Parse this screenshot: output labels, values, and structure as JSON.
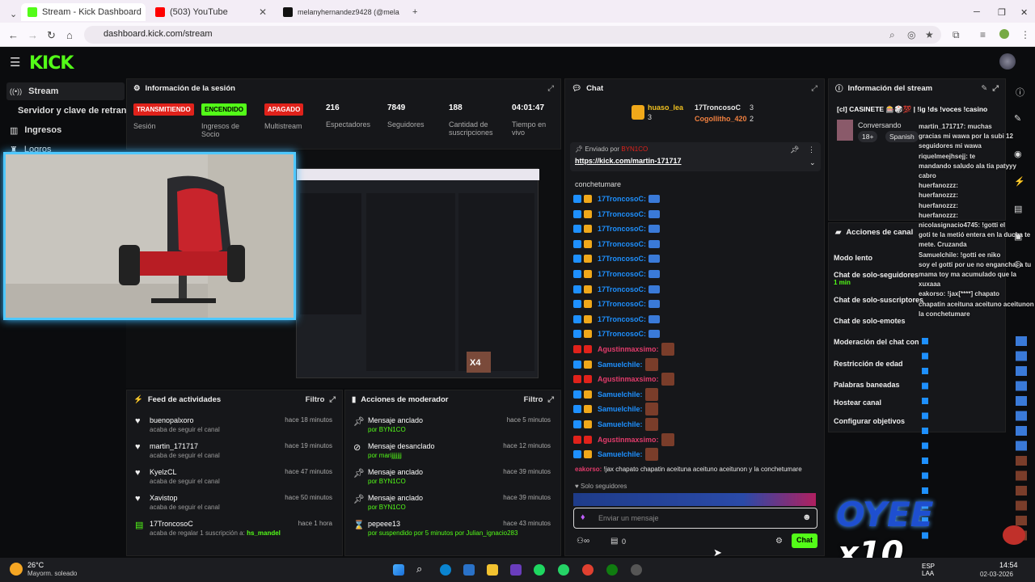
{
  "browser": {
    "tabs": [
      {
        "title": "Stream - Kick Dashboard",
        "active": true
      },
      {
        "title": "(503) YouTube",
        "active": false
      },
      {
        "title": "melanyhernandez9428 (@mela",
        "active": false
      }
    ],
    "url": "dashboard.kick.com/stream"
  },
  "brand": {
    "logo": "KICK",
    "accent": "#53fc18"
  },
  "sidebar": {
    "items": [
      {
        "label": "Stream",
        "icon": "radio-icon"
      },
      {
        "label": "Servidor y clave de retransm",
        "icon": ""
      },
      {
        "label": "Ingresos",
        "icon": "bank-icon"
      },
      {
        "label": "Logros",
        "icon": "trophy-icon"
      }
    ]
  },
  "session": {
    "title": "Información de la sesión",
    "stats": [
      {
        "badge": "TRANSMITIENDO",
        "label": "Sesión"
      },
      {
        "badge": "ENCENDIDO",
        "label": "Ingresos de Socio"
      },
      {
        "badge": "APAGADO",
        "label": "Multistream"
      },
      {
        "value": "216",
        "label": "Espectadores"
      },
      {
        "value": "7849",
        "label": "Seguidores"
      },
      {
        "value": "188",
        "label": "Cantidad de suscripciones"
      },
      {
        "value": "04:01:47",
        "label": "Tiempo en vivo"
      }
    ]
  },
  "feed": {
    "title": "Feed de actividades",
    "filter": "Filtro",
    "items": [
      {
        "name": "buenopalxoro",
        "sub": "acaba de seguir el canal",
        "time": "hace 18 minutos"
      },
      {
        "name": "martin_171717",
        "sub": "acaba de seguir el canal",
        "time": "hace 19 minutos"
      },
      {
        "name": "KyelzCL",
        "sub": "acaba de seguir el canal",
        "time": "hace 47 minutos"
      },
      {
        "name": "Xavistop",
        "sub": "acaba de seguir el canal",
        "time": "hace 50 minutos"
      },
      {
        "name": "17TroncosoC",
        "sub": "acaba de regalar 1 suscripción a:",
        "extra": "hs_mandel",
        "time": "hace 1 hora"
      }
    ]
  },
  "modactions": {
    "title": "Acciones de moderador",
    "filter": "Filtro",
    "items": [
      {
        "name": "Mensaje anclado",
        "sub": "por BYN1CO",
        "time": "hace 5 minutos"
      },
      {
        "name": "Mensaje desanclado",
        "sub": "por marijjjjjjj",
        "time": "hace 12 minutos"
      },
      {
        "name": "Mensaje anclado",
        "sub": "por BYN1CO",
        "time": "hace 39 minutos"
      },
      {
        "name": "Mensaje anclado",
        "sub": "por BYN1CO",
        "time": "hace 39 minutos"
      },
      {
        "name": "pepeee13",
        "sub": "por suspendido por 5 minutos por Julian_ignacio283",
        "time": "hace 43 minutos"
      }
    ]
  },
  "chat": {
    "title": "Chat",
    "top": [
      {
        "name": "huaso_lea",
        "count": "3"
      },
      {
        "name": "17TroncosoC",
        "count": "3"
      },
      {
        "name": "Cogollitho_420",
        "count": "2"
      }
    ],
    "pinned_by": "Enviado por",
    "pinned_user": "BYN1CO",
    "pinned_link": "https://kick.com/martin-171717",
    "pinned_tail": "conchetumare",
    "messages": [
      {
        "user": "17TroncosoC:",
        "color": "#1e90ff"
      },
      {
        "user": "17TroncosoC:",
        "color": "#1e90ff"
      },
      {
        "user": "17TroncosoC:",
        "color": "#1e90ff"
      },
      {
        "user": "17TroncosoC:",
        "color": "#1e90ff"
      },
      {
        "user": "17TroncosoC:",
        "color": "#1e90ff"
      },
      {
        "user": "17TroncosoC:",
        "color": "#1e90ff"
      },
      {
        "user": "17TroncosoC:",
        "color": "#1e90ff"
      },
      {
        "user": "17TroncosoC:",
        "color": "#1e90ff"
      },
      {
        "user": "17TroncosoC:",
        "color": "#1e90ff"
      },
      {
        "user": "17TroncosoC:",
        "color": "#1e90ff"
      },
      {
        "user": "Agustinmaxsimo:",
        "color": "#e23b6b"
      },
      {
        "user": "Samuelchile:",
        "color": "#1e90ff"
      },
      {
        "user": "Agustinmaxsimo:",
        "color": "#e23b6b"
      },
      {
        "user": "Samuelchile:",
        "color": "#1e90ff"
      },
      {
        "user": "Samuelchile:",
        "color": "#1e90ff"
      },
      {
        "user": "Samuelchile:",
        "color": "#1e90ff"
      },
      {
        "user": "Agustinmaxsimo:",
        "color": "#e23b6b"
      },
      {
        "user": "Samuelchile:",
        "color": "#1e90ff"
      }
    ],
    "last_user": "eakorso:",
    "last_text": "!jax chapato chapatin aceituna aceituno aceitunon y la conchetumare",
    "followers_only": "Solo seguidores",
    "input_placeholder": "Enviar un mensaje",
    "points": "0",
    "send_label": "Chat"
  },
  "streaminfo": {
    "title": "Información del stream",
    "stream_title": "[cl] CASINETE 🎰🎲💯 | !ig !ds !voces !casino",
    "category": "Conversando",
    "tags": [
      "18+",
      "Spanish"
    ]
  },
  "channel_actions": {
    "title": "Acciones de canal",
    "items": [
      "Modo lento",
      "Chat de solo-seguidores",
      "Chat de solo-suscriptores",
      "Chat de solo-emotes",
      "Moderación del chat con IA",
      "Restricción de edad",
      "Palabras baneadas",
      "Hostear canal",
      "Configurar objetivos"
    ],
    "follower_sub": "1 min"
  },
  "overlay_chat": [
    "martin_171717: muchas",
    "gracias mi wawa por la subi 12",
    "seguidores mi wawa",
    "riquelmeejhsejj: te",
    "mandando saludo ala tia patyyy",
    "cabro",
    "huerfanozzz:",
    "huerfanozzz:",
    "huerfanozzz:",
    "huerfanozzz:",
    "nicolasignacio4745: !gotti el",
    "goti te la metió entera en la ducha te",
    "mete. Cruzanda",
    "Samuelchile: !gotti ee niko",
    "soy el gotti por ue no enganchai a tu",
    "mama toy ma acumulado que la",
    "xuxaaa",
    "eakorso: !jax[****] chapato",
    "chapatin aceituna aceituno aceitunon y",
    "la conchetumare"
  ],
  "overlay_text": {
    "big": "OYEE",
    "mult": "x10",
    "x4": "X4"
  },
  "taskbar": {
    "weather_temp": "26°C",
    "weather_text": "Mayorm. soleado",
    "time": "14:54",
    "date": "02-03-2026",
    "lang": "ESP\nLAA"
  }
}
